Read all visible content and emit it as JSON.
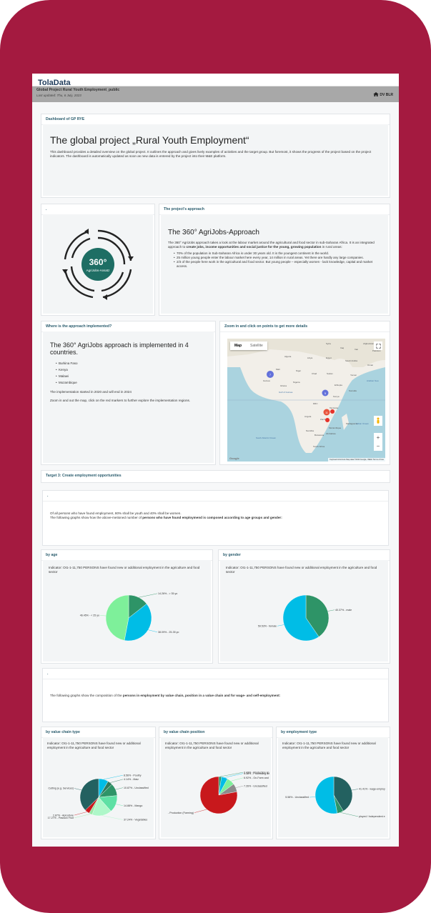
{
  "app": {
    "logo": "TolaData"
  },
  "header": {
    "title": "Global Project Rural Youth Employment_public",
    "updated": "Last updated: Thu, 6 July, 2023",
    "user": "DV BLR"
  },
  "dashboard": {
    "card_title": "Dashboard of GP RYE",
    "heading": "The global project „Rural Youth Employment“",
    "intro": "This dashboard provides a detailed overview on the global project. It outlines the approach and gives lively examples of activities and the target group. But foremost, it shows the progress of the project based on the project indicators. The dashboard is automatically updated as soon as new data is entered by the project into their M&E platform."
  },
  "logo_card": {
    "title": ".",
    "number": "360°",
    "sub": "AgriJobs-Ansatz"
  },
  "approach": {
    "card_title": "The project's approach",
    "heading": "The 360° AgriJobs-Approach",
    "text_plain": "The 360° AgriJobs approach takes a look at the labour market around the agricultural and food sector in sub-Saharan Africa. It is an integrated approach to ",
    "text_bold": "create jobs, income opportunities and social justice for the young, growing population",
    "text_end": " in rural areas:",
    "bullets": [
      "70% of the population in Sub-Saharan Africa is under 30 years old. It is the youngest continent in the world.",
      "25 million young people enter the labour market here every year, 14 million in rural areas. Yet there are hardly any large companies.",
      "2/3 of the people here work in the agricultural and food sector. But young people – especially women - lack knowledge, capital and market access."
    ]
  },
  "where": {
    "card_title": "Where is the approach implemented?",
    "heading": "The 360° AgriJobs approach is implemented in 4 countries.",
    "countries": [
      "Burkina Faso",
      "Kenya",
      "Malawi",
      "Mozambique"
    ],
    "p1": "The implementation started in 2020 and will end in 2024",
    "p2": "Zoom in and out the map, click on the red markers to further explore the implementation regions."
  },
  "map_card": {
    "card_title": "Zoom in and click on points to get more details",
    "tab_map": "Map",
    "tab_satellite": "Satellite",
    "footer": "Keyboard shortcuts   Map data ©2023 Google, INEGI   Terms of Use",
    "google": "Google",
    "labels": [
      "Syria",
      "Iraq",
      "Iran",
      "Afghanistan",
      "Pakistan",
      "Algeria",
      "Libya",
      "Egypt",
      "Saudi Arabia",
      "Oman",
      "Mali",
      "Niger",
      "Chad",
      "Sudan",
      "Yemen",
      "Nigeria",
      "Guinea",
      "Ghana",
      "Ethiopia",
      "Somalia",
      "Kenya",
      "Tanzania",
      "Angola",
      "Zambia",
      "Namibia",
      "Botswana",
      "South Africa",
      "Madagascar",
      "Mozambique",
      "Gulf of Guinea",
      "Arabian Sea",
      "Indian Ocean",
      "South Atlantic Ocean",
      "Zimbabwe",
      "DRC"
    ],
    "cluster_a": "7",
    "cluster_b": "5",
    "cluster_c": "11"
  },
  "target": {
    "card_title": "Target 3: Create employment opportunities"
  },
  "target_text": {
    "title": ".",
    "line1": "Of all persons who have found employment, 80% shall be youth and 40% shall be women.",
    "line2_plain": "The following graphs show how the above-metioned number of ",
    "line2_bold": "persons who have found employmend is composed according to age groups and gender:"
  },
  "by_age": {
    "card_title": "by age",
    "indicator": "Indicator: OI1-1-11,750 PERSONS have found new or additional employment in the agriculture and food sector",
    "labels": [
      "14.26% - > 35 yo",
      "38.09% - 25-35 yo",
      "46.45% - < 25 yo"
    ]
  },
  "by_gender": {
    "card_title": "by gender",
    "indicator": "Indicator: OI1-1-11,750 PERSONS have found new or additional employment in the agriculture and food sector",
    "labels": [
      "40.37% - male",
      "59.53% - female"
    ]
  },
  "comp_text": {
    "title": ".",
    "plain": "The following graphs show the composition of the ",
    "bold": "persons in employment by value chain, position in a value chain and for wage- and self-employment:"
  },
  "vc_type": {
    "card_title": "by value chain type",
    "indicator": "Indicator: OI1-1-11,750 PERSONS have found new or additional employment in the agriculture and food sector",
    "labels": [
      "8.56% - Poultry",
      "4.14% - Maiz",
      "10.87% - Unclassified",
      "14.88% - Mango",
      "37.24% - Vegetables",
      "17.27% - Passion Fruit",
      "2.87% - Apiculture",
      "Cutting (e.g. Services)"
    ]
  },
  "vc_position": {
    "card_title": "by value chain position",
    "indicator": "Indicator: OI1-1-11,750 PERSONS have found new or additional employment in the agriculture and food sector",
    "labels": [
      "2.43% - Production an",
      "5.48% - Processing an",
      "6.92% - On-Farm and",
      "7.26% - Unclassified",
      "- Production (Farming)"
    ]
  },
  "emp_type": {
    "card_title": "by employment type",
    "indicator": "Indicator: OI1-1-11,750 PERSONS have found new or additional employment in the agriculture and food sector",
    "labels": [
      "41.41% - wage-employ",
      "ployed / Independent e",
      "5.58% - Unclassified"
    ]
  },
  "chart_data": [
    {
      "type": "pie",
      "title": "by age",
      "categories": [
        "> 35 yo",
        "25-35 yo",
        "< 25 yo"
      ],
      "values": [
        14.26,
        38.09,
        46.45
      ],
      "colors": [
        "#2e9467",
        "#00bde6",
        "#7ef09a"
      ]
    },
    {
      "type": "pie",
      "title": "by gender",
      "categories": [
        "male",
        "female"
      ],
      "values": [
        40.37,
        59.53
      ],
      "colors": [
        "#2e9467",
        "#00bde6"
      ]
    },
    {
      "type": "pie",
      "title": "by value chain type",
      "categories": [
        "Poultry",
        "Maiz",
        "Unclassified",
        "Mango",
        "Passion Fruit",
        "Apiculture",
        "Cutting (e.g. Services)",
        "Vegetables"
      ],
      "values": [
        8.56,
        4.14,
        10.87,
        14.88,
        17.27,
        2.87,
        4.17,
        37.24
      ],
      "colors": [
        "#00bde6",
        "#2e7a5c",
        "#2e9467",
        "#5ee0a4",
        "#aef7c9",
        "#9be7a8",
        "#c8181c",
        "#236160"
      ]
    },
    {
      "type": "pie",
      "title": "by value chain position",
      "categories": [
        "Production an",
        "Processing an",
        "On-Farm and",
        "Unclassified",
        "Production (Farming)"
      ],
      "values": [
        2.43,
        5.48,
        6.92,
        7.26,
        77.91
      ],
      "colors": [
        "#2e9467",
        "#00bde6",
        "#7ef09a",
        "#8c8c8c",
        "#c8181c"
      ]
    },
    {
      "type": "pie",
      "title": "by employment type",
      "categories": [
        "wage-employ",
        "Unclassified",
        "Self-employed / Independent"
      ],
      "values": [
        41.41,
        5.58,
        53.01
      ],
      "colors": [
        "#236160",
        "#2e9467",
        "#00bde6"
      ]
    }
  ]
}
